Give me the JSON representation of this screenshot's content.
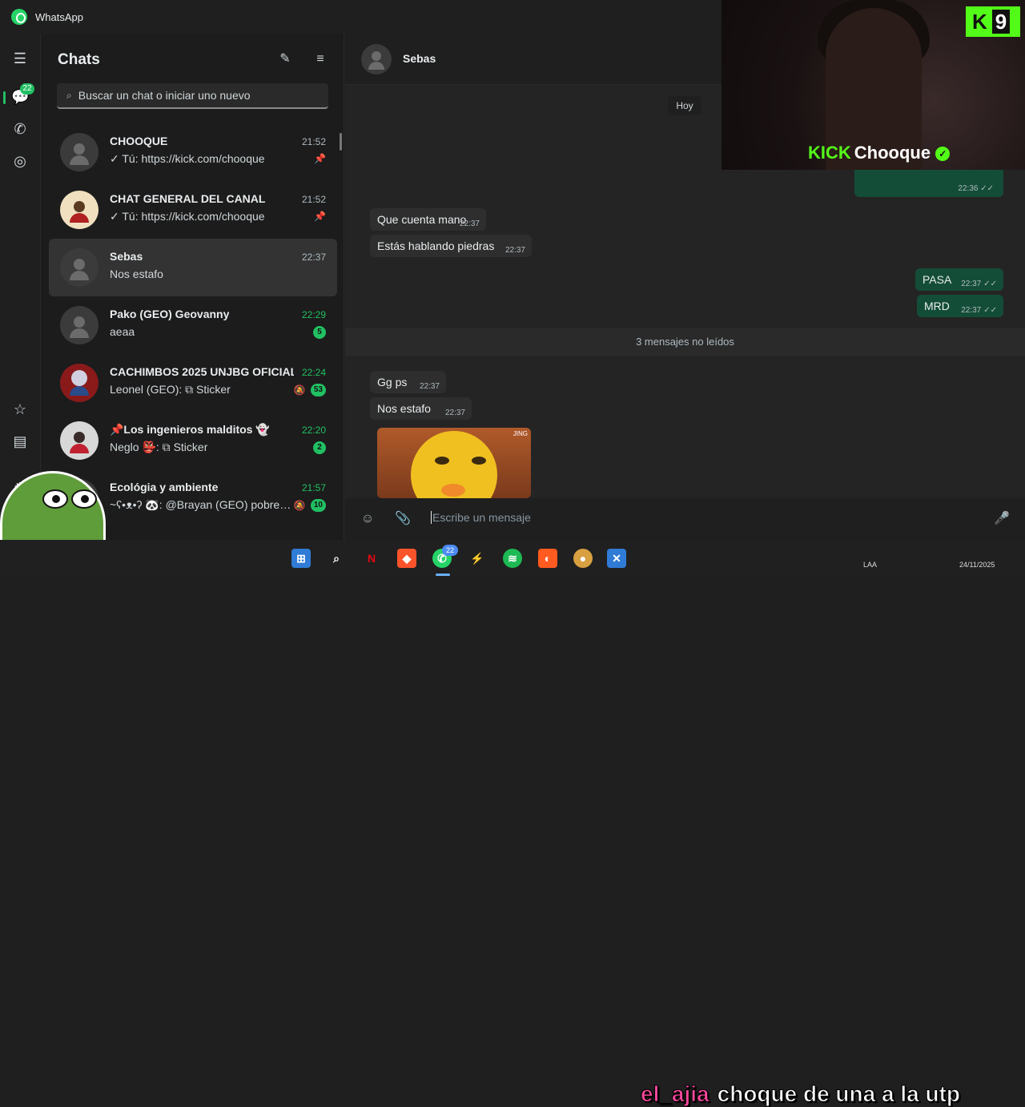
{
  "app": {
    "title": "WhatsApp"
  },
  "rail": {
    "chats_badge": "22"
  },
  "chatlist": {
    "title": "Chats",
    "search_placeholder": "Buscar un chat o iniciar uno nuevo",
    "items": [
      {
        "name": "CHOOQUE",
        "preview": "✓ Tú: https://kick.com/chooque",
        "time": "21:52",
        "pinned": true,
        "unread": "",
        "muted": false
      },
      {
        "name": "CHAT GENERAL DEL CANAL",
        "preview": "✓ Tú: https://kick.com/chooque",
        "time": "21:52",
        "pinned": true,
        "unread": "",
        "muted": false
      },
      {
        "name": "Sebas",
        "preview": "Nos estafo",
        "time": "22:37",
        "pinned": false,
        "unread": "",
        "muted": false
      },
      {
        "name": "Pako (GEO) Geovanny",
        "preview": "aeaa",
        "time": "22:29",
        "pinned": false,
        "unread": "5",
        "muted": false
      },
      {
        "name": "CACHIMBOS 2025 UNJBG OFICIAL",
        "preview": "Leonel (GEO): ⧉ Sticker",
        "time": "22:24",
        "pinned": false,
        "unread": "53",
        "muted": true
      },
      {
        "name": "📌Los ingenieros malditos 👻",
        "preview": "Neglo 👺: ⧉ Sticker",
        "time": "22:20",
        "pinned": false,
        "unread": "2",
        "muted": false
      },
      {
        "name": "Ecológia y ambiente",
        "preview": "~ʕ•ᴥ•ʔ 🐼: @Brayan (GEO) pobre. F...",
        "time": "21:57",
        "pinned": false,
        "unread": "10",
        "muted": true
      }
    ]
  },
  "conversation": {
    "contact_name": "Sebas",
    "day_label": "Hoy",
    "unread_divider": "3 mensajes no leídos",
    "peek_time": "22:36",
    "messages": [
      {
        "dir": "in",
        "text": "Que cuenta mano",
        "time": "22:37"
      },
      {
        "dir": "in",
        "text": "Estás hablando piedras",
        "time": "22:37"
      },
      {
        "dir": "out",
        "text": "PASA",
        "time": "22:37"
      },
      {
        "dir": "out",
        "text": "MRD",
        "time": "22:37"
      },
      {
        "dir": "in",
        "text": "Gg ps",
        "time": "22:37"
      },
      {
        "dir": "in",
        "text": "Nos estafo",
        "time": "22:37"
      }
    ],
    "sticker_tag": "JING",
    "composer_placeholder": "Escribe un mensaje"
  },
  "stream": {
    "kick_badge_letter": "K",
    "kick_badge_number": "9",
    "brand_kick": "KICK",
    "brand_name": "Chooque",
    "overlay_nick": "el_ajia",
    "overlay_message": "choque de una a la utp"
  },
  "taskbar": {
    "whatsapp_badge": "22",
    "lang": "LAA",
    "date": "24/11/2025"
  },
  "colors": {
    "accent_green": "#21c063",
    "outgoing_bubble": "#144d37",
    "kick_green": "#53fc18"
  }
}
